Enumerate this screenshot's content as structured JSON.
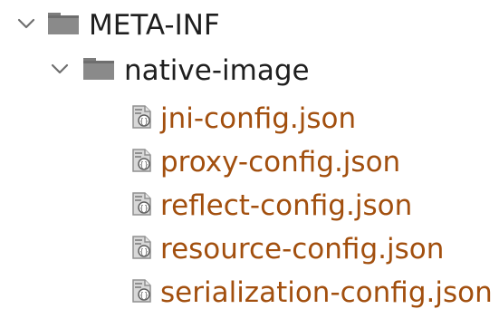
{
  "colors": {
    "folder_text": "#1f1f1f",
    "file_text": "#a24f0e",
    "folder_icon": "#7d7d7d",
    "chevron": "#6f6f6f"
  },
  "tree": {
    "root": {
      "label": "META-INF",
      "expanded": true,
      "icon": "folder-icon"
    },
    "child": {
      "label": "native-image",
      "expanded": true,
      "icon": "folder-icon"
    },
    "files": [
      {
        "label": "jni-config.json",
        "icon": "json-file-icon"
      },
      {
        "label": "proxy-config.json",
        "icon": "json-file-icon"
      },
      {
        "label": "reflect-config.json",
        "icon": "json-file-icon"
      },
      {
        "label": "resource-config.json",
        "icon": "json-file-icon"
      },
      {
        "label": "serialization-config.json",
        "icon": "json-file-icon"
      }
    ]
  }
}
